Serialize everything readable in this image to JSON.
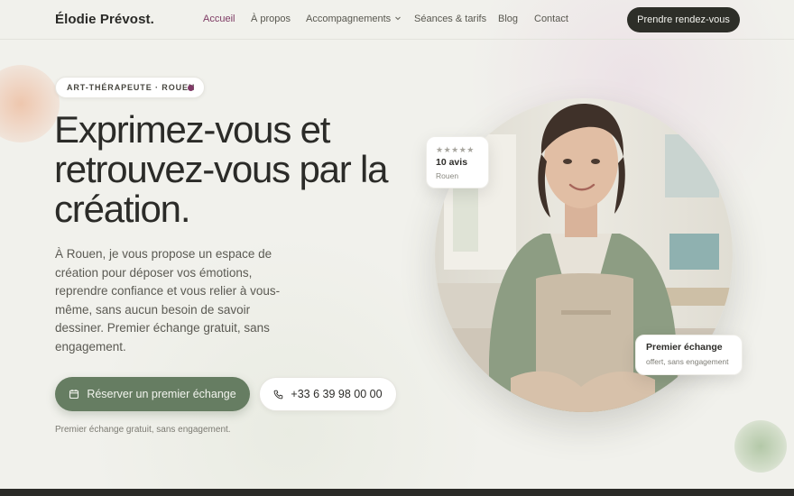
{
  "header": {
    "brand": "Élodie Prévost.",
    "nav": [
      {
        "label": "Accueil",
        "active": true
      },
      {
        "label": "À propos",
        "active": false
      },
      {
        "label": "Accompagnements",
        "active": false,
        "has_dropdown": true
      },
      {
        "label": "Séances & tarifs",
        "active": false
      },
      {
        "label": "Blog",
        "active": false
      },
      {
        "label": "Contact",
        "active": false
      }
    ],
    "cta": "Prendre rendez-vous"
  },
  "hero": {
    "badge": "ART-THÉRAPEUTE · ROUEN",
    "title_lines": [
      "Exprimez-vous et",
      "retrouvez-vous par la",
      "création."
    ],
    "lead": "À Rouen, je vous propose un espace de création pour déposer vos émotions, reprendre confiance et vous relier à vous-même, sans aucun besoin de savoir dessiner. Premier échange gratuit, sans engagement.",
    "primary_button": "Réserver un premier échange",
    "phone_button": "+33 6 39 98 00 00",
    "note": "Premier échange gratuit, sans engagement."
  },
  "reviews_card": {
    "stars": "★★★★★",
    "rating_stars": 5,
    "count": "10 avis",
    "location": "Rouen"
  },
  "offer_card": {
    "title": "Premier échange",
    "subtitle": "offert, sans engagement"
  },
  "colors": {
    "accent": "#7d3a63",
    "primary_button": "#667d62",
    "dark": "#2d2e28",
    "background": "#f1f1ec"
  },
  "icons": {
    "calendar": "calendar-icon",
    "phone": "phone-icon",
    "dropdown": "chevron-down-icon"
  }
}
